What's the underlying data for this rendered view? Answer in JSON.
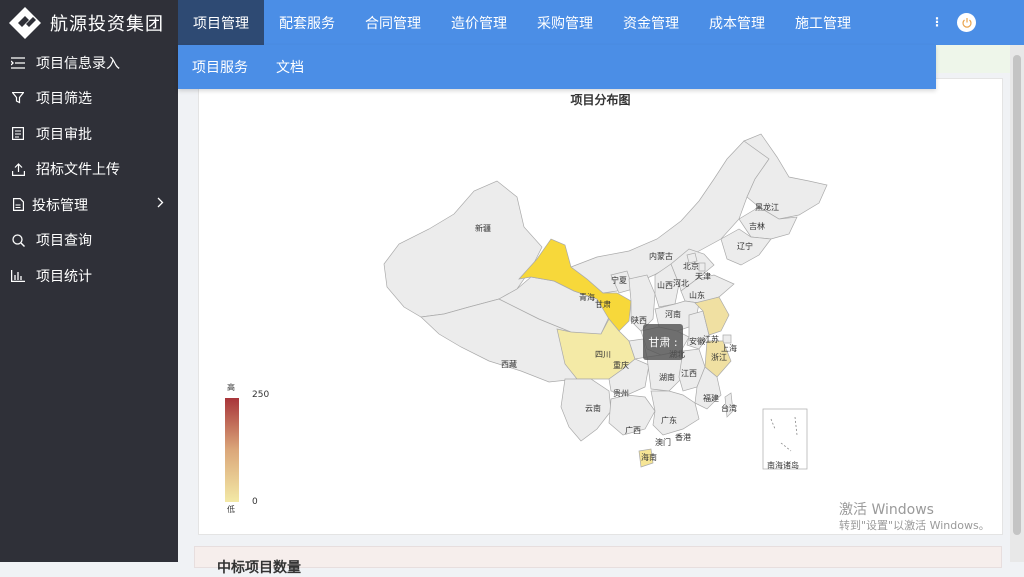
{
  "app": {
    "title": "航源投资集团"
  },
  "sidebar": {
    "items": [
      {
        "label": "项目信息录入",
        "icon": "list-indent-icon"
      },
      {
        "label": "项目筛选",
        "icon": "filter-icon"
      },
      {
        "label": "项目审批",
        "icon": "document-list-icon"
      },
      {
        "label": "招标文件上传",
        "icon": "upload-icon"
      },
      {
        "label": "投标管理",
        "icon": "document-icon"
      },
      {
        "label": "项目查询",
        "icon": "search-icon"
      },
      {
        "label": "项目统计",
        "icon": "bar-chart-icon"
      }
    ]
  },
  "topnav": {
    "tabs": [
      "项目管理",
      "配套服务",
      "合同管理",
      "造价管理",
      "采购管理",
      "资金管理",
      "成本管理",
      "施工管理"
    ],
    "more": "⋮"
  },
  "submenu": {
    "items": [
      "项目服务",
      "文档"
    ]
  },
  "map": {
    "title": "项目分布图",
    "tooltip": "甘肃 :",
    "legend": {
      "high": "高",
      "low": "低",
      "max": "250",
      "min": "0"
    },
    "colors": {
      "gansu": "#f7d83a",
      "sichuan": "#f4eaa6",
      "jiangsu_zhejiang": "#f0e0a2",
      "hainan": "#f6e595",
      "default": "#ececec"
    },
    "labels": {
      "xinjiang": "新疆",
      "xizang": "西藏",
      "qinghai": "青海",
      "gansu": "甘肃",
      "neimenggu": "内蒙古",
      "ningxia": "宁夏",
      "shaanxi": "陕西",
      "shanxi": "山西",
      "hebei": "河北",
      "beijing": "北京",
      "tianjin": "天津",
      "shandong": "山东",
      "henan": "河南",
      "heilongjiang": "黑龙江",
      "jilin": "吉林",
      "liaoning": "辽宁",
      "sichuan": "四川",
      "chongqing": "重庆",
      "hubei": "湖北",
      "anhui": "安徽",
      "jiangsu": "江苏",
      "shanghai": "上海",
      "zhejiang": "浙江",
      "hunan": "湖南",
      "jiangxi": "江西",
      "guizhou": "贵州",
      "yunnan": "云南",
      "guangxi": "广西",
      "guangdong": "广东",
      "fujian": "福建",
      "taiwan": "台湾",
      "hongkong": "香港",
      "macau": "澳门",
      "hainan": "海南",
      "nanhai": "南海诸岛"
    }
  },
  "watermark": {
    "line1": "激活 Windows",
    "line2": "转到\"设置\"以激活 Windows。"
  },
  "next_card": {
    "title": "中标项目数量"
  }
}
